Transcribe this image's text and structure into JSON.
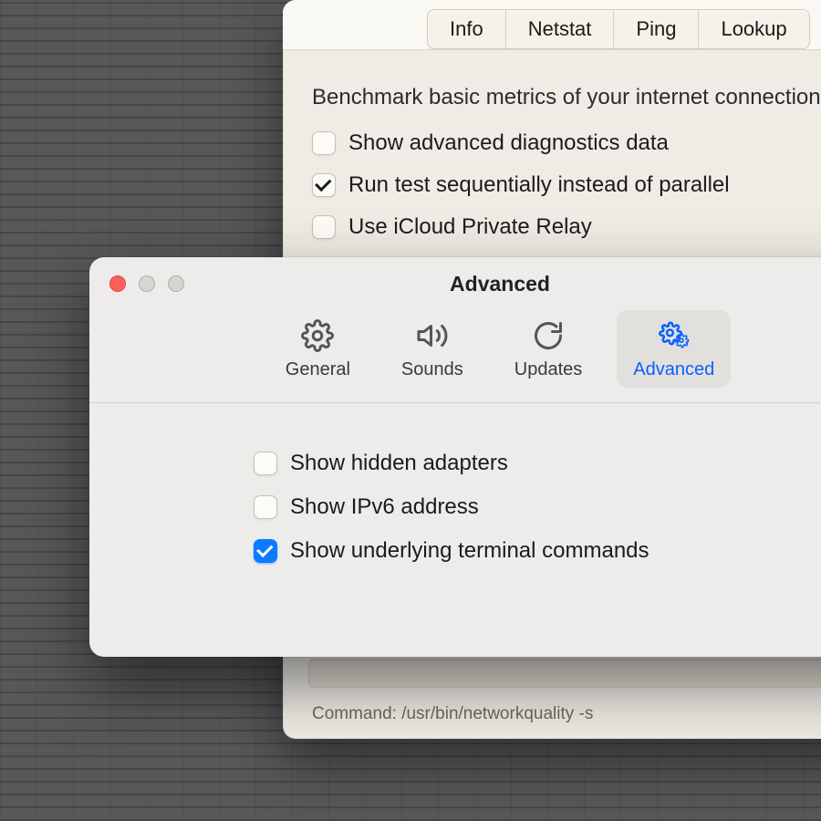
{
  "backWindow": {
    "tabs": [
      "Info",
      "Netstat",
      "Ping",
      "Lookup"
    ],
    "heading": "Benchmark basic metrics of your internet connection",
    "options": [
      {
        "label": "Show advanced diagnostics data",
        "checked": false
      },
      {
        "label": "Run test sequentially instead of parallel",
        "checked": true
      },
      {
        "label": "Use iCloud Private Relay",
        "checked": false
      }
    ],
    "commandPrefix": "Command: ",
    "commandValue": "/usr/bin/networkquality -s"
  },
  "frontWindow": {
    "title": "Advanced",
    "toolbar": [
      {
        "id": "general",
        "label": "General"
      },
      {
        "id": "sounds",
        "label": "Sounds"
      },
      {
        "id": "updates",
        "label": "Updates"
      },
      {
        "id": "advanced",
        "label": "Advanced"
      }
    ],
    "selectedToolbar": "advanced",
    "options": [
      {
        "label": "Show hidden adapters",
        "checked": false
      },
      {
        "label": "Show IPv6 address",
        "checked": false
      },
      {
        "label": "Show underlying terminal commands",
        "checked": true
      }
    ]
  },
  "colors": {
    "accent": "#0a7bff"
  }
}
